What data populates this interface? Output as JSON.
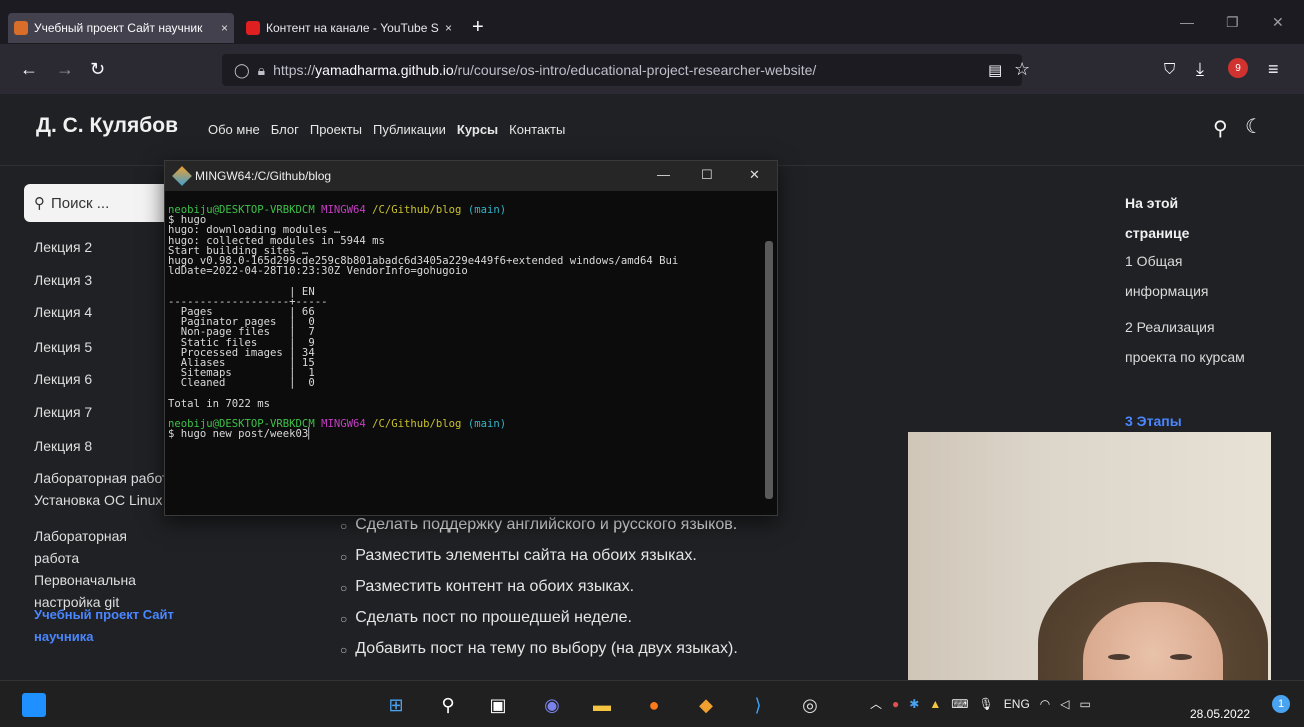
{
  "browser": {
    "tabs": [
      {
        "label": "Учебный проект Сайт научник",
        "icon": "favicon-orange",
        "active": true
      },
      {
        "label": "Контент на канале - YouTube S",
        "icon": "youtube-icon",
        "active": false
      }
    ],
    "close_glyph": "×",
    "new_tab_glyph": "+",
    "url_prefix": "https://",
    "url_host": "yamadharma.github.io",
    "url_path": "/ru/course/os-intro/educational-project-researcher-website/",
    "addon_badge": "9"
  },
  "site": {
    "title": "Д. С. Кулябов",
    "nav": [
      "Обо мне",
      "Блог",
      "Проекты",
      "Публикации",
      "Курсы",
      "Контакты"
    ],
    "search_placeholder": "Поиск ...",
    "sidebar": [
      "Лекция 2",
      "Лекция 3",
      "Лекция 4",
      "Лекция 5",
      "Лекция 6",
      "Лекция 7",
      "Лекция 8",
      "Лабораторная работ Установка ОС Linux",
      "Лабораторная работа Первоначальна настройка git",
      "Учебный проект Сайт научника"
    ],
    "toc_title": "На этой странице",
    "toc": [
      "1 Общая информация",
      "2 Реализация проекта по курсам",
      "3 Этапы"
    ],
    "tasks": [
      "Сделать поддержку английского и русского языков.",
      "Разместить элементы сайта на обоих языках.",
      "Разместить контент на обоих языках.",
      "Сделать пост по прошедшей неделе.",
      "Добавить пост на тему по выбору (на двух языках)."
    ]
  },
  "terminal": {
    "title": "MINGW64:/C/Github/blog",
    "prompt_user": "neobiju@DESKTOP-VRBKDCM",
    "prompt_env": "MINGW64",
    "prompt_path": "/C/Github/blog",
    "prompt_branch": "(main)",
    "lines": [
      "$ hugo",
      "hugo: downloading modules …",
      "hugo: collected modules in 5944 ms",
      "Start building sites …",
      "hugo v0.98.0-165d299cde259c8b801abadc6d3405a229e449f6+extended windows/amd64 Bui",
      "ldDate=2022-04-28T10:23:30Z VendorInfo=gohugoio",
      "",
      "                   | EN",
      "-------------------+-----",
      "  Pages            | 66",
      "  Paginator pages  |  0",
      "  Non-page files   |  7",
      "  Static files     |  9",
      "  Processed images | 34",
      "  Aliases          | 15",
      "  Sitemaps         |  1",
      "  Cleaned          |  0",
      "",
      "Total in 7022 ms",
      ""
    ],
    "last_command": "$ hugo new post/week03"
  },
  "taskbar": {
    "lang": "ENG",
    "date": "28.05.2022",
    "notifications": "1"
  },
  "colors": {
    "link_blue": "#4a86ff",
    "prompt_green": "#3fc04a",
    "prompt_magenta": "#c53ec5",
    "prompt_yellow": "#c9c12c",
    "prompt_cyan": "#33b3c7"
  }
}
